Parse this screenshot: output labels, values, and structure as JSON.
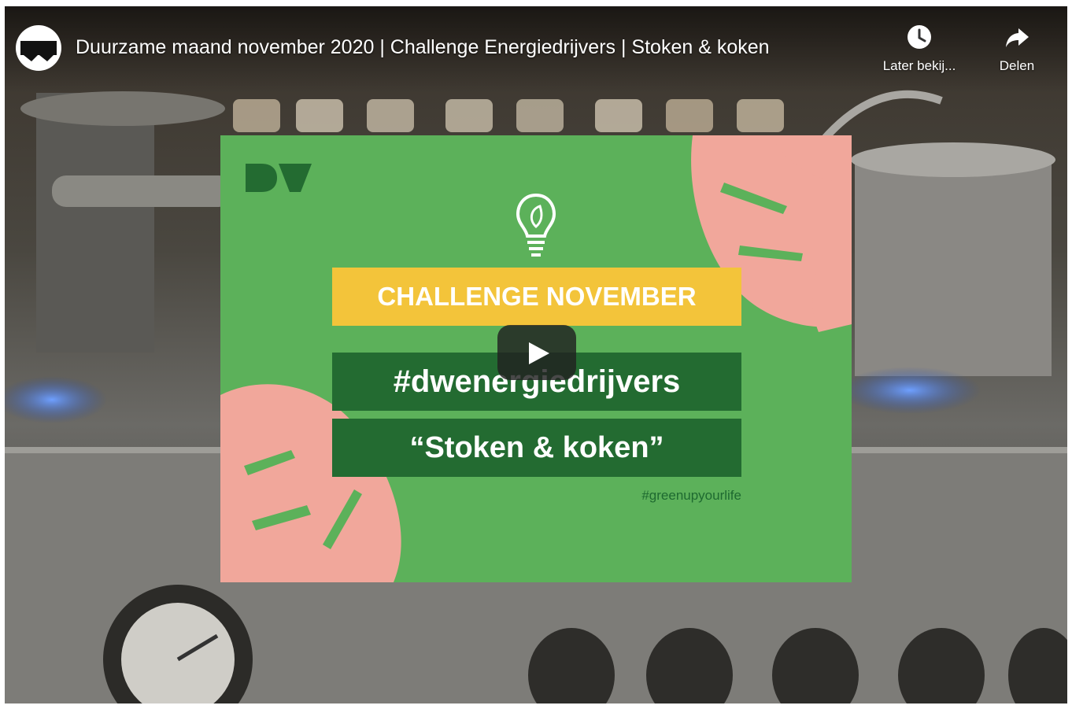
{
  "video": {
    "title": "Duurzame maand november 2020 | Challenge Energiedrijvers | Stoken & koken",
    "channel_avatar_icon": "dw-channel-logo"
  },
  "controls": {
    "watch_later_label": "Later bekij...",
    "share_label": "Delen",
    "watch_later_icon": "clock-icon",
    "share_icon": "share-arrow-icon",
    "play_icon": "play-icon"
  },
  "thumbnail": {
    "logo_text": "DW",
    "challenge_label": "CHALLENGE NOVEMBER",
    "hashtag": "#dwenergiedrijvers",
    "subtitle": "“Stoken & koken”",
    "secondary_hashtag": "#greenupyourlife",
    "bulb_icon": "lightbulb-leaf-icon"
  },
  "colors": {
    "card_green": "#5cb15a",
    "dark_green": "#236b31",
    "yellow": "#f3c43a",
    "pink": "#f1a79b"
  }
}
